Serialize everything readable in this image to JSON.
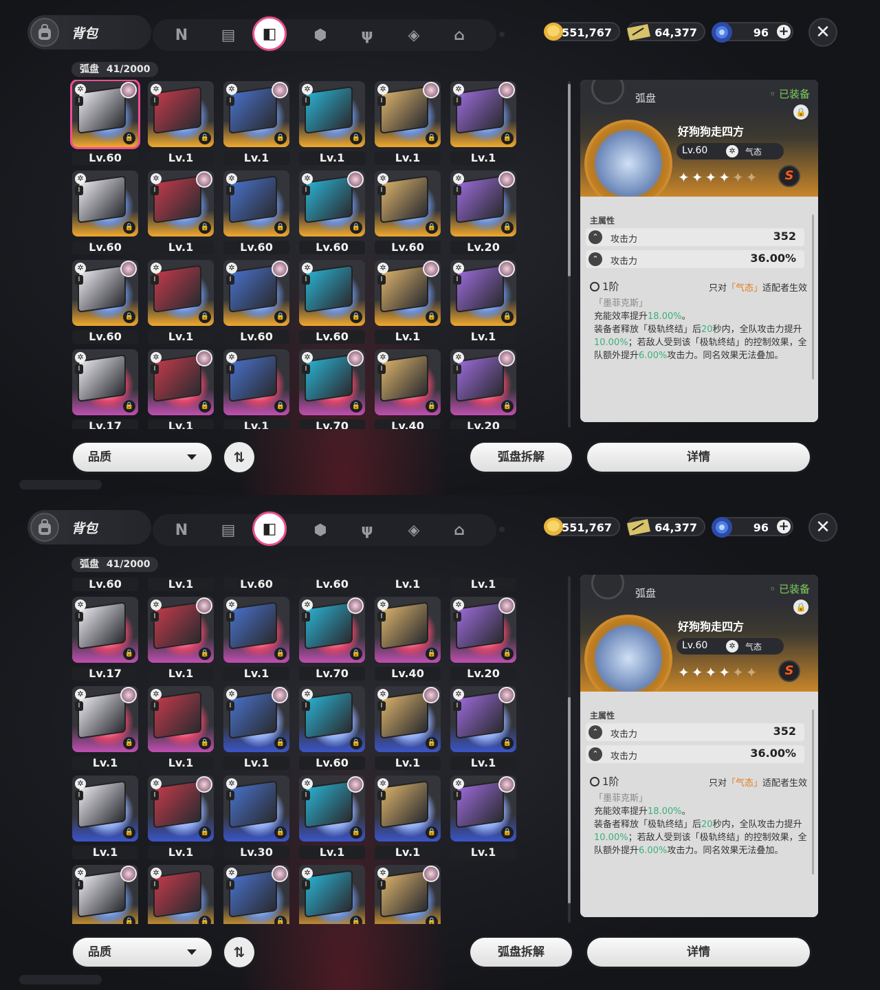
{
  "header": {
    "bag_title": "背包",
    "categories": [
      {
        "name": "n-icon",
        "glyph": "N"
      },
      {
        "name": "gameboy-icon",
        "glyph": "▤"
      },
      {
        "name": "disc-drive-icon",
        "glyph": "◧"
      },
      {
        "name": "box-icon",
        "glyph": "⬢"
      },
      {
        "name": "cutlery-icon",
        "glyph": "ψ"
      },
      {
        "name": "cube-icon",
        "glyph": "◈"
      },
      {
        "name": "home-icon",
        "glyph": "⌂"
      }
    ],
    "active_category_index": 2,
    "currencies": [
      {
        "name": "coin",
        "value": "551,767",
        "color": "#e8b53a"
      },
      {
        "name": "ticket",
        "value": "64,377",
        "color": "#d8c36a"
      },
      {
        "name": "energy",
        "value": "96",
        "color": "#4f7fe0"
      }
    ]
  },
  "inventory": {
    "category_label": "弧盘",
    "count": "41/2000"
  },
  "panels": [
    {
      "grid_rows": [
        [
          "Lv.60",
          "Lv.1",
          "Lv.1",
          "Lv.1",
          "Lv.1",
          "Lv.1"
        ],
        [
          "Lv.60",
          "Lv.1",
          "Lv.60",
          "Lv.60",
          "Lv.60",
          "Lv.20"
        ],
        [
          "Lv.60",
          "Lv.1",
          "Lv.60",
          "Lv.60",
          "Lv.1",
          "Lv.1"
        ],
        [
          "Lv.17",
          "Lv.1",
          "Lv.1",
          "Lv.70",
          "Lv.40",
          "Lv.20"
        ]
      ],
      "tiers": [
        [
          "gold",
          "gold",
          "gold",
          "gold",
          "gold",
          "gold"
        ],
        [
          "gold",
          "gold",
          "gold",
          "gold",
          "gold",
          "gold"
        ],
        [
          "gold",
          "gold",
          "gold",
          "gold",
          "gold",
          "gold"
        ],
        [
          "purple",
          "purple",
          "purple",
          "purple",
          "purple",
          "purple"
        ]
      ],
      "grid_offset": 0,
      "selected": [
        0,
        0
      ]
    },
    {
      "grid_rows": [
        [
          "Lv.60",
          "Lv.1",
          "Lv.60",
          "Lv.60",
          "Lv.1",
          "Lv.1"
        ],
        [
          "Lv.17",
          "Lv.1",
          "Lv.1",
          "Lv.70",
          "Lv.40",
          "Lv.20"
        ],
        [
          "Lv.1",
          "Lv.1",
          "Lv.1",
          "Lv.60",
          "Lv.1",
          "Lv.1"
        ],
        [
          "Lv.1",
          "Lv.1",
          "Lv.30",
          "Lv.1",
          "Lv.1",
          "Lv.1"
        ],
        [
          "",
          "",
          "",
          "",
          "",
          ""
        ]
      ],
      "tiers": [
        [
          "gold",
          "gold",
          "gold",
          "gold",
          "gold",
          "gold"
        ],
        [
          "purple",
          "purple",
          "purple",
          "purple",
          "purple",
          "purple"
        ],
        [
          "purple",
          "purple",
          "blue",
          "blue",
          "blue",
          "blue"
        ],
        [
          "blue",
          "blue",
          "blue",
          "blue",
          "blue",
          "blue"
        ],
        [
          "gold",
          "gold",
          "gold",
          "gold",
          "gold",
          ""
        ]
      ],
      "grid_offset": 1,
      "selected": null
    }
  ],
  "detail": {
    "category": "弧盘",
    "equipped": "已装备",
    "name": "好狗狗走四方",
    "level": "Lv.60",
    "attribute": "气态",
    "stars_filled": 4,
    "stars_total": 6,
    "rank": "S",
    "main_attr_label": "主属性",
    "stats": [
      {
        "name": "攻击力",
        "value": "352"
      },
      {
        "name": "攻击力",
        "value": "36.00%"
      }
    ],
    "tier": "1阶",
    "tier_note_prefix": "只对",
    "tier_note_attr": "「气态」",
    "tier_note_suffix": "适配者生效",
    "set_name": "「墨菲克斯」",
    "desc1_a": "充能效率提升",
    "desc1_b": "18.00%",
    "desc1_c": "。",
    "desc2_a": "装备者释放「极轨终结」后",
    "desc2_b": "20",
    "desc2_c": "秒内，全队攻击力提升",
    "desc2_d": "10.00%",
    "desc2_e": "；若敌人受到该「极轨终结」的控制效果，全队额外提升",
    "desc2_f": "6.00%",
    "desc2_g": "攻击力。同名效果无法叠加。"
  },
  "footer": {
    "quality_label": "品质",
    "sort_glyph": "⇅",
    "dismantle_label": "弧盘拆解",
    "details_label": "详情"
  }
}
